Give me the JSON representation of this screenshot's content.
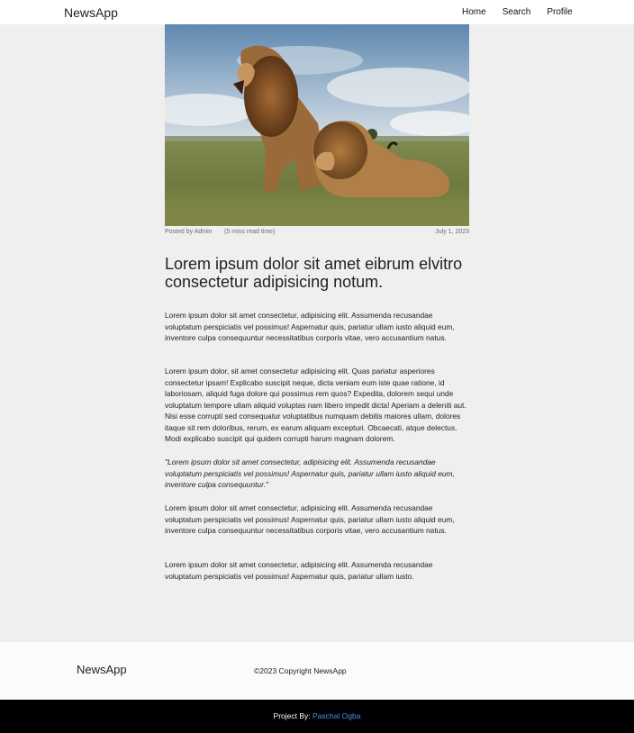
{
  "navbar": {
    "brand": "NewsApp",
    "links": [
      {
        "label": "Home"
      },
      {
        "label": "Search"
      },
      {
        "label": "Profile"
      }
    ]
  },
  "article": {
    "posted_by": "Posted by Admin",
    "read_time": "(5 mins read time)",
    "date": "July 1, 2023",
    "title": "Lorem ipsum dolor sit amet eibrum elvitro consectetur adipisicing notum.",
    "paragraphs": [
      "Lorem ipsum dolor sit amet consectetur, adipisicing elit. Assumenda recusandae voluptatum perspiciatis vel possimus! Aspernatur quis, pariatur ullam iusto aliquid eum, inventore culpa consequuntur necessitatibus corporis vitae, vero accusantium natus.",
      "Lorem ipsum dolor, sit amet consectetur adipisicing elit. Quas pariatur asperiores consectetur ipsam! Explicabo suscipit neque, dicta veniam eum iste quae ratione, id laboriosam, aliquid fuga dolore qui possimus rem quos? Expedita, dolorem sequi unde voluptatum tempore ullam aliquid voluptas nam libero impedit dicta! Aperiam a deleniti aut. Nisi esse corrupti sed consequatur voluptatibus numquam debitis maiores ullam, dolores itaque sit rem doloribus, rerum, ex earum aliquam excepturi. Obcaecati, atque delectus. Modi explicabo suscipit qui quidem corrupti harum magnam dolorem.",
      "\"Lorem ipsum dolor sit amet consectetur, adipisicing elit. Assumenda recusandae voluptatum perspiciatis vel possimus! Aspernatur quis, pariatur ullam iusto aliquid eum, inventore culpa consequuntur.\"",
      "Lorem ipsum dolor sit amet consectetur, adipisicing elit. Assumenda recusandae voluptatum perspiciatis vel possimus! Aspernatur quis, pariatur ullam iusto aliquid eum, inventore culpa consequuntur necessitatibus corporis vitae, vero accusantium natus.",
      "Lorem ipsum dolor sit amet consectetur, adipisicing elit. Assumenda recusandae voluptatum perspiciatis vel possimus! Aspernatur quis, pariatur ullam iusto."
    ]
  },
  "footer": {
    "brand": "NewsApp",
    "copyright": "©2023 Copyright NewsApp",
    "credit_prefix": "Project By:",
    "credit_name": "Paschal Ogba"
  },
  "colors": {
    "page_background": "#efefef",
    "footer_bar": "#000000",
    "credit_link": "#4a8fe0"
  }
}
